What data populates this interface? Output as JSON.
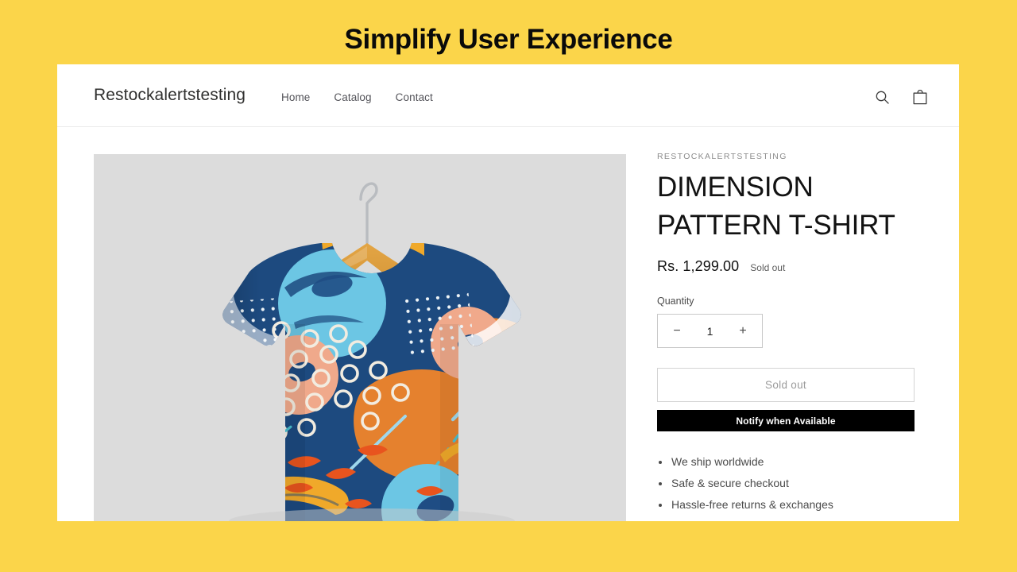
{
  "banner": {
    "title": "Simplify User Experience",
    "background_color": "#fbd54a"
  },
  "header": {
    "store_name": "Restockalertstesting",
    "nav": [
      {
        "label": "Home"
      },
      {
        "label": "Catalog"
      },
      {
        "label": "Contact"
      }
    ],
    "icons": [
      {
        "name": "search-icon"
      },
      {
        "name": "cart-icon"
      }
    ]
  },
  "product": {
    "vendor": "RESTOCKALERTSTESTING",
    "title_line1": "DIMENSION",
    "title_line2": "PATTERN T-SHIRT",
    "price": "Rs. 1,299.00",
    "availability_badge": "Sold out",
    "quantity": {
      "label": "Quantity",
      "decrease_symbol": "−",
      "value": "1",
      "increase_symbol": "+"
    },
    "buttons": {
      "add_to_cart": "Sold out",
      "notify": "Notify when Available",
      "notify_bg": "#000000"
    },
    "benefits": [
      "We ship worldwide",
      "Safe & secure checkout",
      "Hassle-free returns & exchanges"
    ],
    "image": {
      "name": "dimension-pattern-t-shirt-on-wooden-hanger",
      "background_color": "#dcdcdc",
      "shirt_base_color": "#1d4a7f",
      "accent_colors": [
        "#e5812e",
        "#6cc6e4",
        "#f0a98b",
        "#f0a92a",
        "#f2ece0"
      ]
    }
  }
}
